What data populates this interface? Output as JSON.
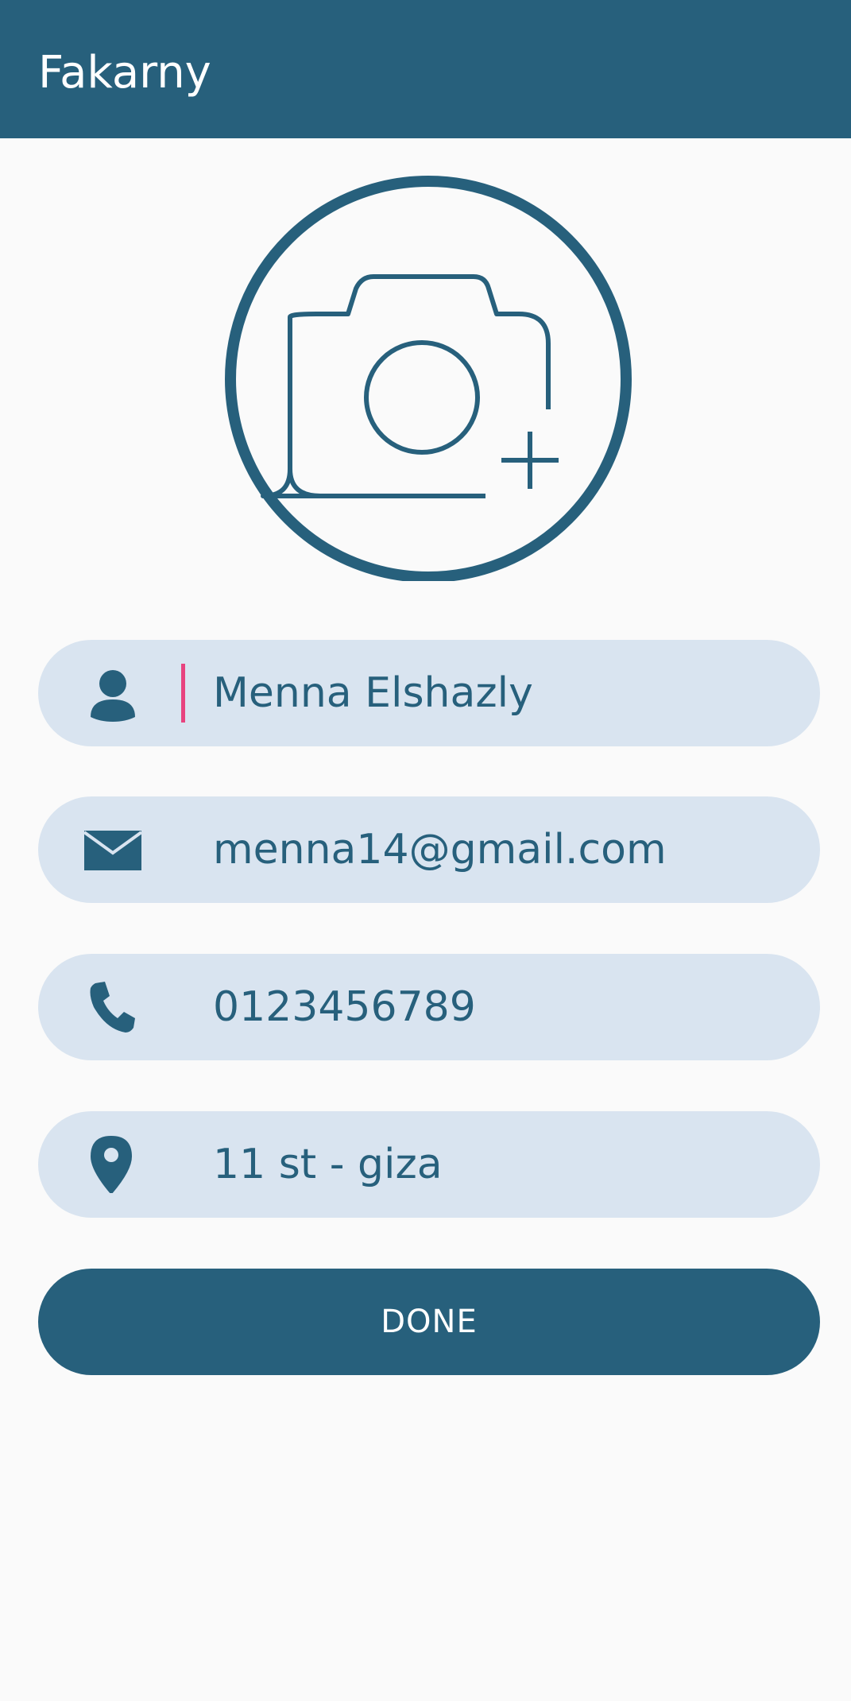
{
  "app_bar": {
    "title": "Fakarny"
  },
  "avatar": {
    "icon": "add-photo-camera-icon"
  },
  "form": {
    "name": {
      "icon": "person-icon",
      "value": "Menna Elshazly"
    },
    "email": {
      "icon": "mail-icon",
      "value": "menna14@gmail.com"
    },
    "phone": {
      "icon": "phone-icon",
      "value": "0123456789"
    },
    "address": {
      "icon": "location-pin-icon",
      "value": "11 st - giza"
    }
  },
  "actions": {
    "done_label": "DONE"
  },
  "colors": {
    "primary": "#27607c",
    "field_background": "#d9e4f0",
    "page_background": "#fafafa",
    "cursor": "#e8437f"
  }
}
